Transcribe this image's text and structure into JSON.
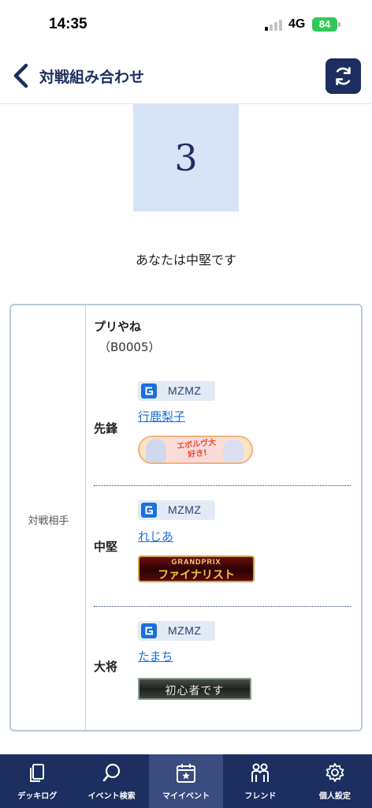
{
  "status_bar": {
    "time": "14:35",
    "network": "4G",
    "battery": "84",
    "battery_color": "#34c759"
  },
  "header": {
    "title": "対戦組み合わせ",
    "back_icon": "chevron-left-icon",
    "refresh_icon": "refresh-icon",
    "accent_color": "#1c2f60"
  },
  "order": {
    "number": "3",
    "message": "あなたは中堅です"
  },
  "opponent": {
    "label": "対戦相手",
    "team_name": "プリやね",
    "team_code": "（B0005）",
    "members": [
      {
        "role": "先鋒",
        "team_chip": "MZMZ",
        "player": "行鹿梨子",
        "badge_text": "エボルヴ大好き!"
      },
      {
        "role": "中堅",
        "team_chip": "MZMZ",
        "player": "れじあ",
        "badge_top": "GRANDPRIX",
        "badge_main": "ファイナリスト"
      },
      {
        "role": "大将",
        "team_chip": "MZMZ",
        "player": "たまち",
        "badge_text": "初心者です"
      }
    ]
  },
  "tabs": [
    {
      "label": "デッキログ",
      "icon": "deck-icon",
      "active": false
    },
    {
      "label": "イベント検索",
      "icon": "search-icon",
      "active": false
    },
    {
      "label": "マイイベント",
      "icon": "calendar-star-icon",
      "active": true
    },
    {
      "label": "フレンド",
      "icon": "friends-icon",
      "active": false
    },
    {
      "label": "個人設定",
      "icon": "gear-icon",
      "active": false
    }
  ]
}
